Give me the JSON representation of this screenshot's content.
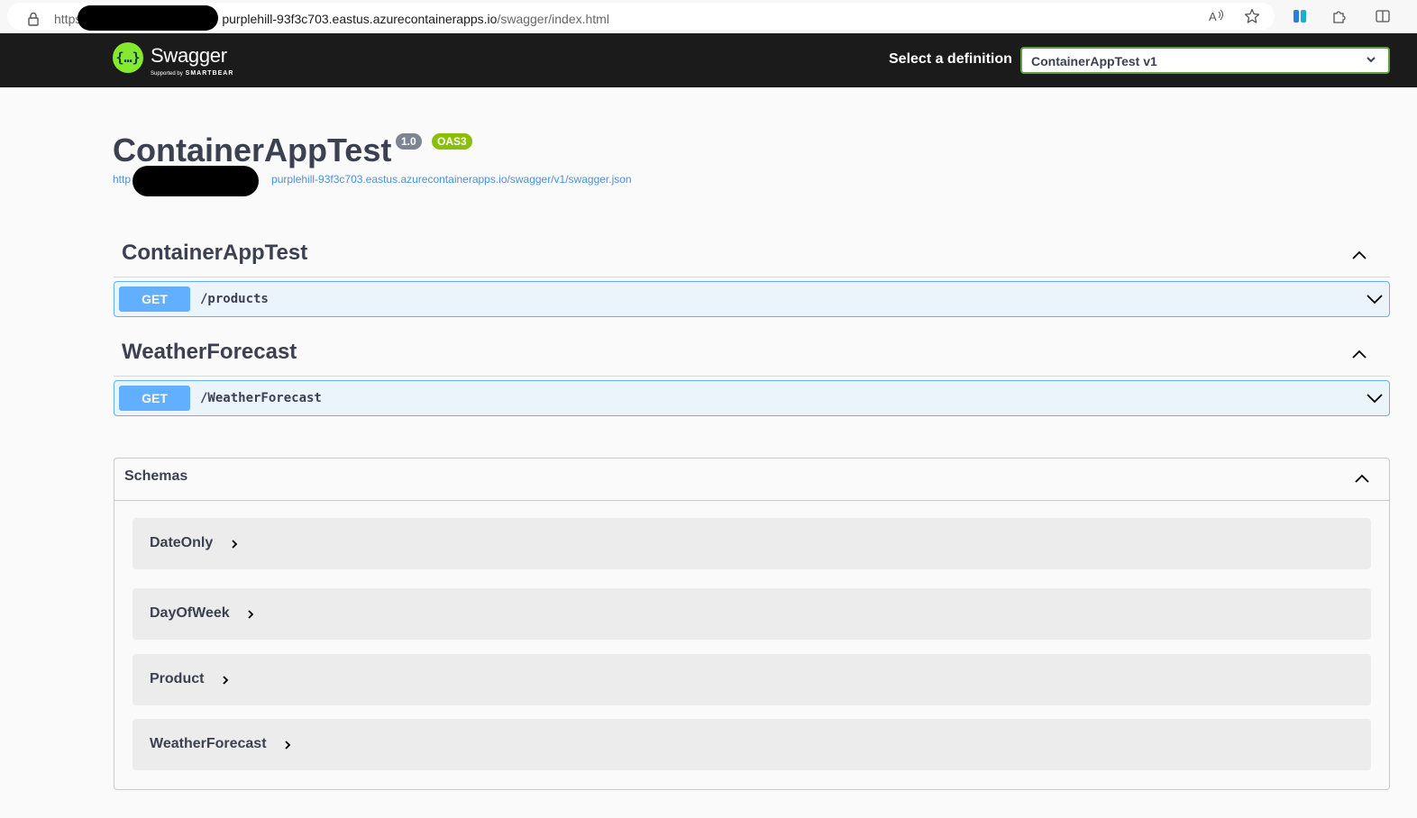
{
  "browser": {
    "url_scheme": "https",
    "url_host": "purplehill-93f3c703.eastus.azurecontainerapps.io",
    "url_path": "/swagger/index.html"
  },
  "topbar": {
    "logo_text": "Swagger",
    "logo_sub_prefix": "Supported by",
    "logo_sub_brand": "SMARTBEAR",
    "select_label": "Select a definition",
    "selected_definition": "ContainerAppTest v1"
  },
  "info": {
    "title": "ContainerAppTest",
    "version_badge": "1.0",
    "oas_badge": "OAS3",
    "spec_url_prefix": "http",
    "spec_url_rest": "purplehill-93f3c703.eastus.azurecontainerapps.io/swagger/v1/swagger.json"
  },
  "tags": [
    {
      "name": "ContainerAppTest",
      "operations": [
        {
          "method": "GET",
          "path": "/products"
        }
      ]
    },
    {
      "name": "WeatherForecast",
      "operations": [
        {
          "method": "GET",
          "path": "/WeatherForecast"
        }
      ]
    }
  ],
  "schemas": {
    "title": "Schemas",
    "models": [
      "DateOnly",
      "DayOfWeek",
      "Product",
      "WeatherForecast"
    ]
  },
  "colors": {
    "topbar_bg": "#1b1b1b",
    "get_method": "#61affe",
    "get_bg": "#ebf3fb",
    "oas_badge": "#89bf04",
    "version_badge": "#7d8492",
    "select_border": "#62a03f",
    "link": "#4990e2"
  },
  "icons": [
    "lock-icon",
    "read-aloud-icon",
    "favorite-star-icon",
    "copilot-icon",
    "extensions-icon",
    "split-screen-icon",
    "swagger-logo-icon",
    "chevron-down-icon",
    "chevron-up-icon",
    "chevron-right-icon"
  ]
}
